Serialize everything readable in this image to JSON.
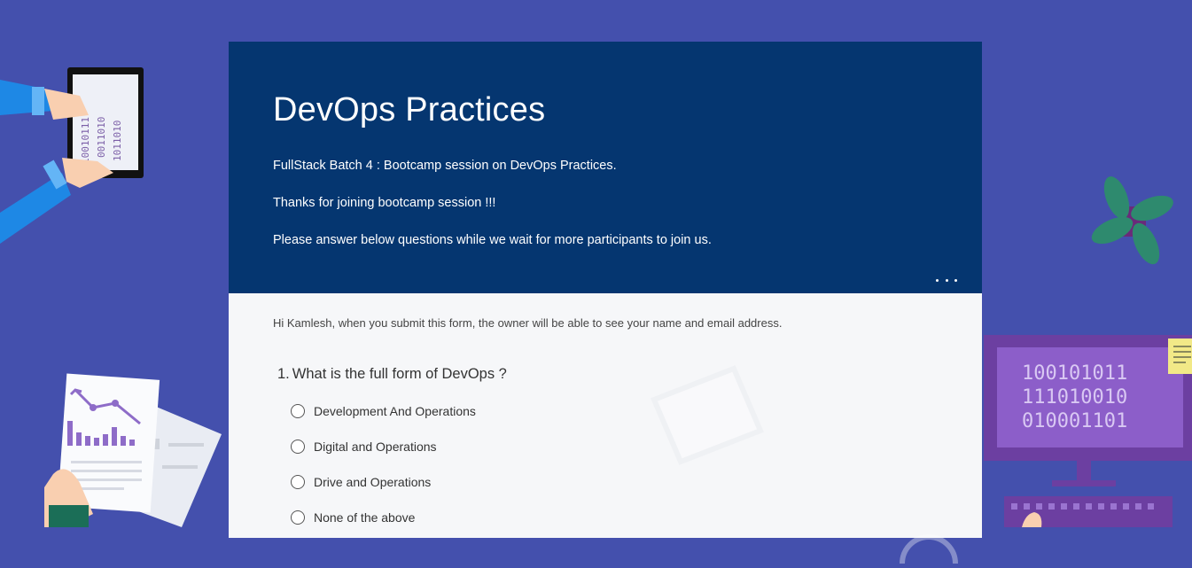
{
  "form": {
    "title": "DevOps Practices",
    "description": [
      "FullStack Batch 4 : Bootcamp session on DevOps Practices.",
      "Thanks for joining bootcamp session !!!",
      "Please answer below questions while we wait for more participants to join us."
    ],
    "more_icon": "ellipsis-icon",
    "notice": "Hi Kamlesh, when you submit this form, the owner will be able to see your name and email address."
  },
  "questions": [
    {
      "number": "1.",
      "text": "What is the full form of DevOps ?",
      "options": [
        "Development And Operations",
        "Digital and Operations",
        "Drive and Operations",
        "None of the above"
      ]
    }
  ],
  "decorations": {
    "monitor_rows": [
      "100101011",
      "111010010",
      "010001101"
    ],
    "tablet_columns": [
      "10010111",
      "0011010",
      "1011010"
    ]
  },
  "colors": {
    "background": "#4450ad",
    "header": "#053670",
    "card": "#f6f7f9"
  }
}
